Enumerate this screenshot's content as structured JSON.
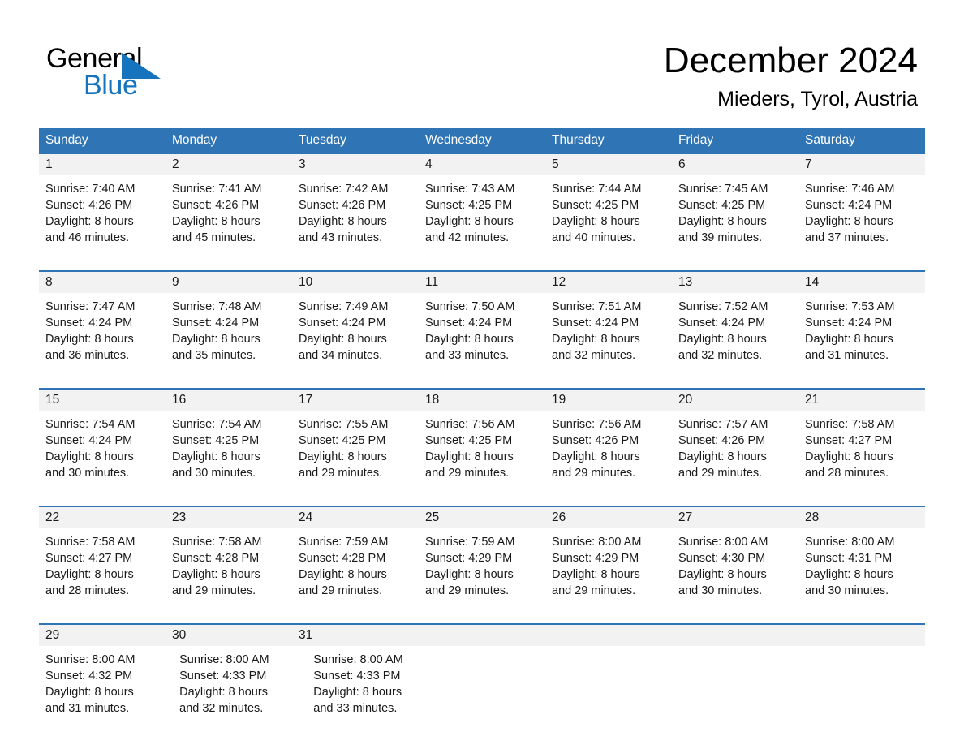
{
  "brand": {
    "line1": "General",
    "line2": "Blue",
    "triangle_icon": "triangle-icon",
    "black": "#000000",
    "blue": "#1673bd"
  },
  "header": {
    "month_title": "December 2024",
    "location": "Mieders, Tyrol, Austria"
  },
  "theme": {
    "header_blue": "#2f74b5",
    "date_band_gray": "#f2f2f2",
    "cell_white": "#ffffff",
    "text_black": "#1a1a1a"
  },
  "weekdays": [
    "Sunday",
    "Monday",
    "Tuesday",
    "Wednesday",
    "Thursday",
    "Friday",
    "Saturday"
  ],
  "weeks": [
    {
      "days": [
        {
          "date": "1",
          "sunrise": "Sunrise: 7:40 AM",
          "sunset": "Sunset: 4:26 PM",
          "daylight_1": "Daylight: 8 hours",
          "daylight_2": "and 46 minutes."
        },
        {
          "date": "2",
          "sunrise": "Sunrise: 7:41 AM",
          "sunset": "Sunset: 4:26 PM",
          "daylight_1": "Daylight: 8 hours",
          "daylight_2": "and 45 minutes."
        },
        {
          "date": "3",
          "sunrise": "Sunrise: 7:42 AM",
          "sunset": "Sunset: 4:26 PM",
          "daylight_1": "Daylight: 8 hours",
          "daylight_2": "and 43 minutes."
        },
        {
          "date": "4",
          "sunrise": "Sunrise: 7:43 AM",
          "sunset": "Sunset: 4:25 PM",
          "daylight_1": "Daylight: 8 hours",
          "daylight_2": "and 42 minutes."
        },
        {
          "date": "5",
          "sunrise": "Sunrise: 7:44 AM",
          "sunset": "Sunset: 4:25 PM",
          "daylight_1": "Daylight: 8 hours",
          "daylight_2": "and 40 minutes."
        },
        {
          "date": "6",
          "sunrise": "Sunrise: 7:45 AM",
          "sunset": "Sunset: 4:25 PM",
          "daylight_1": "Daylight: 8 hours",
          "daylight_2": "and 39 minutes."
        },
        {
          "date": "7",
          "sunrise": "Sunrise: 7:46 AM",
          "sunset": "Sunset: 4:24 PM",
          "daylight_1": "Daylight: 8 hours",
          "daylight_2": "and 37 minutes."
        }
      ]
    },
    {
      "days": [
        {
          "date": "8",
          "sunrise": "Sunrise: 7:47 AM",
          "sunset": "Sunset: 4:24 PM",
          "daylight_1": "Daylight: 8 hours",
          "daylight_2": "and 36 minutes."
        },
        {
          "date": "9",
          "sunrise": "Sunrise: 7:48 AM",
          "sunset": "Sunset: 4:24 PM",
          "daylight_1": "Daylight: 8 hours",
          "daylight_2": "and 35 minutes."
        },
        {
          "date": "10",
          "sunrise": "Sunrise: 7:49 AM",
          "sunset": "Sunset: 4:24 PM",
          "daylight_1": "Daylight: 8 hours",
          "daylight_2": "and 34 minutes."
        },
        {
          "date": "11",
          "sunrise": "Sunrise: 7:50 AM",
          "sunset": "Sunset: 4:24 PM",
          "daylight_1": "Daylight: 8 hours",
          "daylight_2": "and 33 minutes."
        },
        {
          "date": "12",
          "sunrise": "Sunrise: 7:51 AM",
          "sunset": "Sunset: 4:24 PM",
          "daylight_1": "Daylight: 8 hours",
          "daylight_2": "and 32 minutes."
        },
        {
          "date": "13",
          "sunrise": "Sunrise: 7:52 AM",
          "sunset": "Sunset: 4:24 PM",
          "daylight_1": "Daylight: 8 hours",
          "daylight_2": "and 32 minutes."
        },
        {
          "date": "14",
          "sunrise": "Sunrise: 7:53 AM",
          "sunset": "Sunset: 4:24 PM",
          "daylight_1": "Daylight: 8 hours",
          "daylight_2": "and 31 minutes."
        }
      ]
    },
    {
      "days": [
        {
          "date": "15",
          "sunrise": "Sunrise: 7:54 AM",
          "sunset": "Sunset: 4:24 PM",
          "daylight_1": "Daylight: 8 hours",
          "daylight_2": "and 30 minutes."
        },
        {
          "date": "16",
          "sunrise": "Sunrise: 7:54 AM",
          "sunset": "Sunset: 4:25 PM",
          "daylight_1": "Daylight: 8 hours",
          "daylight_2": "and 30 minutes."
        },
        {
          "date": "17",
          "sunrise": "Sunrise: 7:55 AM",
          "sunset": "Sunset: 4:25 PM",
          "daylight_1": "Daylight: 8 hours",
          "daylight_2": "and 29 minutes."
        },
        {
          "date": "18",
          "sunrise": "Sunrise: 7:56 AM",
          "sunset": "Sunset: 4:25 PM",
          "daylight_1": "Daylight: 8 hours",
          "daylight_2": "and 29 minutes."
        },
        {
          "date": "19",
          "sunrise": "Sunrise: 7:56 AM",
          "sunset": "Sunset: 4:26 PM",
          "daylight_1": "Daylight: 8 hours",
          "daylight_2": "and 29 minutes."
        },
        {
          "date": "20",
          "sunrise": "Sunrise: 7:57 AM",
          "sunset": "Sunset: 4:26 PM",
          "daylight_1": "Daylight: 8 hours",
          "daylight_2": "and 29 minutes."
        },
        {
          "date": "21",
          "sunrise": "Sunrise: 7:58 AM",
          "sunset": "Sunset: 4:27 PM",
          "daylight_1": "Daylight: 8 hours",
          "daylight_2": "and 28 minutes."
        }
      ]
    },
    {
      "days": [
        {
          "date": "22",
          "sunrise": "Sunrise: 7:58 AM",
          "sunset": "Sunset: 4:27 PM",
          "daylight_1": "Daylight: 8 hours",
          "daylight_2": "and 28 minutes."
        },
        {
          "date": "23",
          "sunrise": "Sunrise: 7:58 AM",
          "sunset": "Sunset: 4:28 PM",
          "daylight_1": "Daylight: 8 hours",
          "daylight_2": "and 29 minutes."
        },
        {
          "date": "24",
          "sunrise": "Sunrise: 7:59 AM",
          "sunset": "Sunset: 4:28 PM",
          "daylight_1": "Daylight: 8 hours",
          "daylight_2": "and 29 minutes."
        },
        {
          "date": "25",
          "sunrise": "Sunrise: 7:59 AM",
          "sunset": "Sunset: 4:29 PM",
          "daylight_1": "Daylight: 8 hours",
          "daylight_2": "and 29 minutes."
        },
        {
          "date": "26",
          "sunrise": "Sunrise: 8:00 AM",
          "sunset": "Sunset: 4:29 PM",
          "daylight_1": "Daylight: 8 hours",
          "daylight_2": "and 29 minutes."
        },
        {
          "date": "27",
          "sunrise": "Sunrise: 8:00 AM",
          "sunset": "Sunset: 4:30 PM",
          "daylight_1": "Daylight: 8 hours",
          "daylight_2": "and 30 minutes."
        },
        {
          "date": "28",
          "sunrise": "Sunrise: 8:00 AM",
          "sunset": "Sunset: 4:31 PM",
          "daylight_1": "Daylight: 8 hours",
          "daylight_2": "and 30 minutes."
        }
      ]
    },
    {
      "days": [
        {
          "date": "29",
          "sunrise": "Sunrise: 8:00 AM",
          "sunset": "Sunset: 4:32 PM",
          "daylight_1": "Daylight: 8 hours",
          "daylight_2": "and 31 minutes."
        },
        {
          "date": "30",
          "sunrise": "Sunrise: 8:00 AM",
          "sunset": "Sunset: 4:33 PM",
          "daylight_1": "Daylight: 8 hours",
          "daylight_2": "and 32 minutes."
        },
        {
          "date": "31",
          "sunrise": "Sunrise: 8:00 AM",
          "sunset": "Sunset: 4:33 PM",
          "daylight_1": "Daylight: 8 hours",
          "daylight_2": "and 33 minutes."
        },
        null,
        null,
        null,
        null
      ]
    }
  ]
}
